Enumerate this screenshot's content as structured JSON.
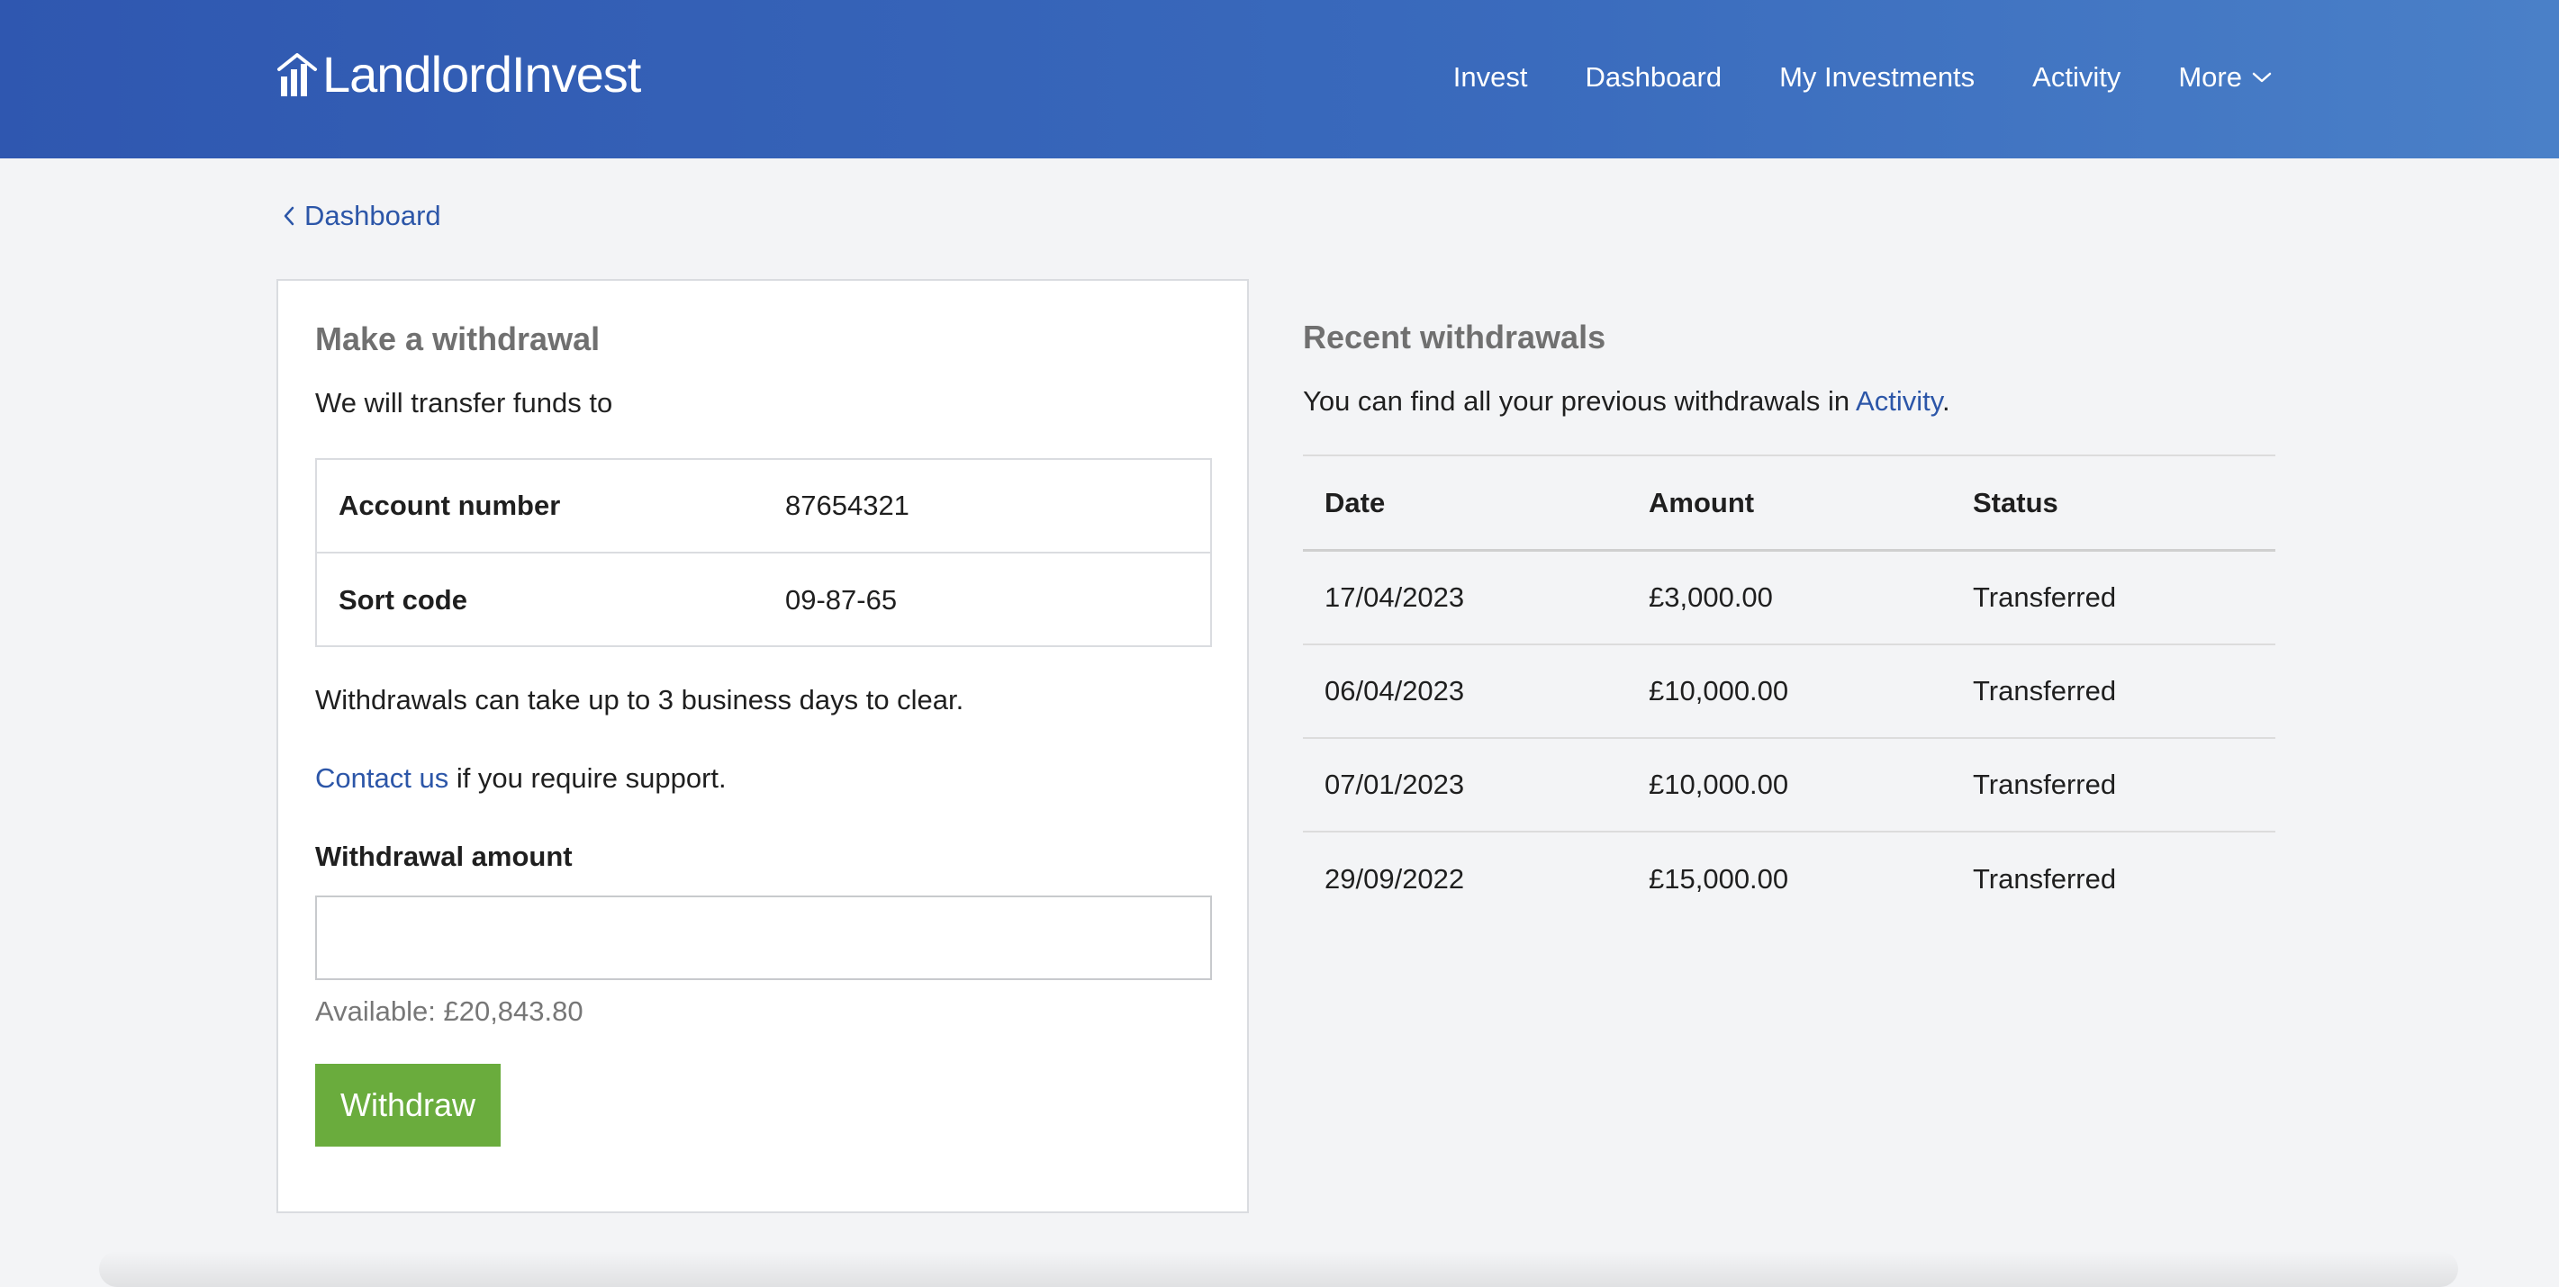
{
  "header": {
    "logo_text": "LandlordInvest",
    "nav": [
      {
        "label": "Invest"
      },
      {
        "label": "Dashboard"
      },
      {
        "label": "My Investments"
      },
      {
        "label": "Activity"
      },
      {
        "label": "More"
      }
    ]
  },
  "breadcrumb": {
    "back_label": "Dashboard"
  },
  "withdraw_card": {
    "title": "Make a withdrawal",
    "subtitle": "We will transfer funds to",
    "account": [
      {
        "label": "Account number",
        "value": "87654321"
      },
      {
        "label": "Sort code",
        "value": "09-87-65"
      }
    ],
    "clear_note": "Withdrawals can take up to 3 business days to clear.",
    "contact_link": "Contact us",
    "contact_rest": " if you require support.",
    "amount_label": "Withdrawal amount",
    "amount_value": "",
    "amount_placeholder": "",
    "available": "Available: £20,843.80",
    "button_label": "Withdraw"
  },
  "recent": {
    "title": "Recent withdrawals",
    "sub_prefix": "You can find all your previous withdrawals in ",
    "sub_link": "Activity",
    "sub_suffix": ".",
    "columns": [
      "Date",
      "Amount",
      "Status"
    ],
    "rows": [
      {
        "date": "17/04/2023",
        "amount": "£3,000.00",
        "status": "Transferred"
      },
      {
        "date": "06/04/2023",
        "amount": "£10,000.00",
        "status": "Transferred"
      },
      {
        "date": "07/01/2023",
        "amount": "£10,000.00",
        "status": "Transferred"
      },
      {
        "date": "29/09/2022",
        "amount": "£15,000.00",
        "status": "Transferred"
      }
    ]
  },
  "colors": {
    "header_start": "#2f57b0",
    "header_end": "#4a80c8",
    "link": "#2c56a8",
    "button": "#6aac3d",
    "background": "#f3f4f6"
  },
  "icons": {
    "logo": "bar-chart-roof-icon",
    "more": "chevron-down-icon",
    "back": "chevron-left-icon"
  }
}
